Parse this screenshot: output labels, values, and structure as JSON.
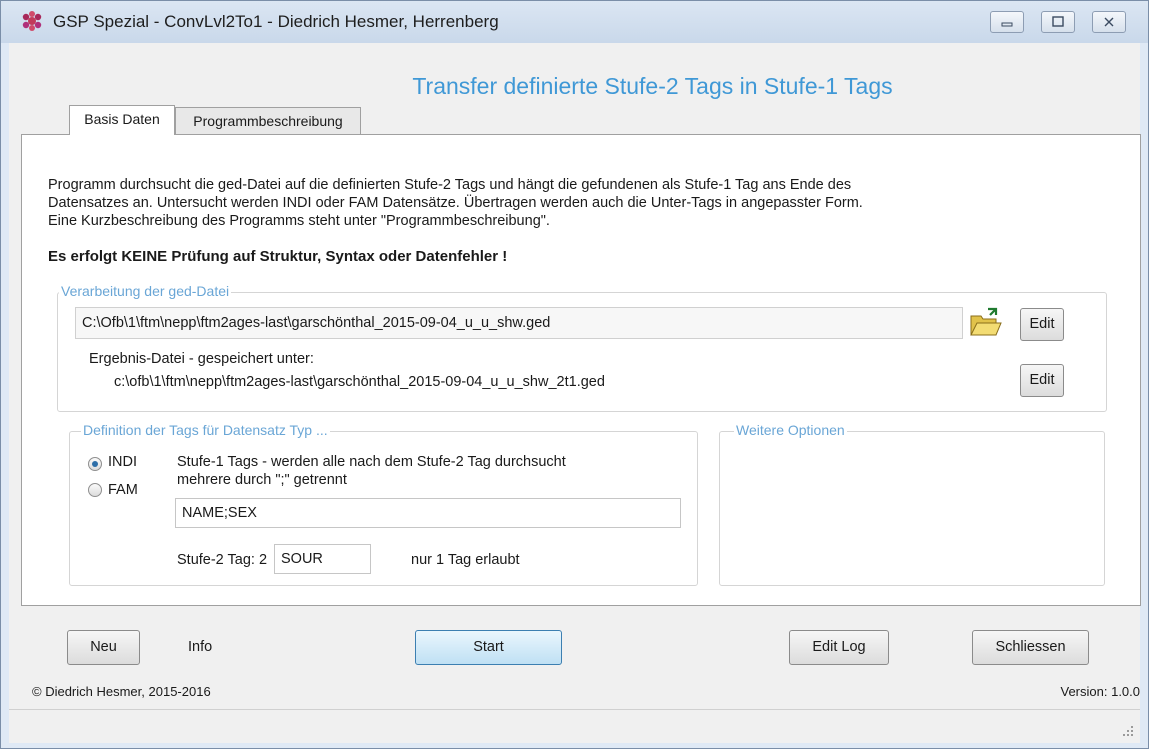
{
  "window": {
    "title": "GSP Spezial - ConvLvl2To1  -  Diedrich Hesmer, Herrenberg",
    "controls": [
      "minimize",
      "maximize",
      "close"
    ]
  },
  "heading": "Transfer definierte Stufe-2 Tags in Stufe-1 Tags",
  "tabs": [
    {
      "label": "Basis Daten",
      "active": true
    },
    {
      "label": "Programmbeschreibung",
      "active": false
    }
  ],
  "description": {
    "line1": "Programm durchsucht die ged-Datei auf die definierten Stufe-2 Tags und hängt die gefundenen als Stufe-1 Tag ans Ende des",
    "line2": "Datensatzes an. Untersucht werden INDI oder FAM Datensätze. Übertragen werden auch die Unter-Tags in angepasster Form.",
    "line3": "Eine Kurzbeschreibung des Programms steht unter \"Programmbeschreibung\".",
    "warning": "Es erfolgt KEINE Prüfung auf Struktur, Syntax oder Datenfehler !"
  },
  "processing": {
    "legend": "Verarbeitung der ged-Datei",
    "input_path": "C:\\Ofb\\1\\ftm\\nepp\\ftm2ages-last\\garschönthal_2015-09-04_u_u_shw.ged",
    "edit_label": "Edit",
    "result_label": "Ergebnis-Datei - gespeichert unter:",
    "result_path": "c:\\ofb\\1\\ftm\\nepp\\ftm2ages-last\\garschönthal_2015-09-04_u_u_shw_2t1.ged",
    "edit_result_label": "Edit"
  },
  "definition": {
    "legend": "Definition der Tags für Datensatz Typ ...",
    "radio_indi": "INDI",
    "radio_fam": "FAM",
    "selected": "INDI",
    "hint1": "Stufe-1 Tags - werden alle nach dem Stufe-2 Tag durchsucht",
    "hint2": "mehrere durch \";\" getrennt",
    "tags_value": "NAME;SEX",
    "level2_label": "Stufe-2 Tag: 2",
    "level2_value": "SOUR",
    "level2_hint": "nur 1 Tag erlaubt"
  },
  "options": {
    "legend": "Weitere Optionen"
  },
  "buttons": {
    "new": "Neu",
    "info": "Info",
    "start": "Start",
    "edit_log": "Edit Log",
    "close": "Schliessen"
  },
  "footer": {
    "copyright": "© Diedrich Hesmer, 2015-2016",
    "version": "Version: 1.0.0"
  }
}
